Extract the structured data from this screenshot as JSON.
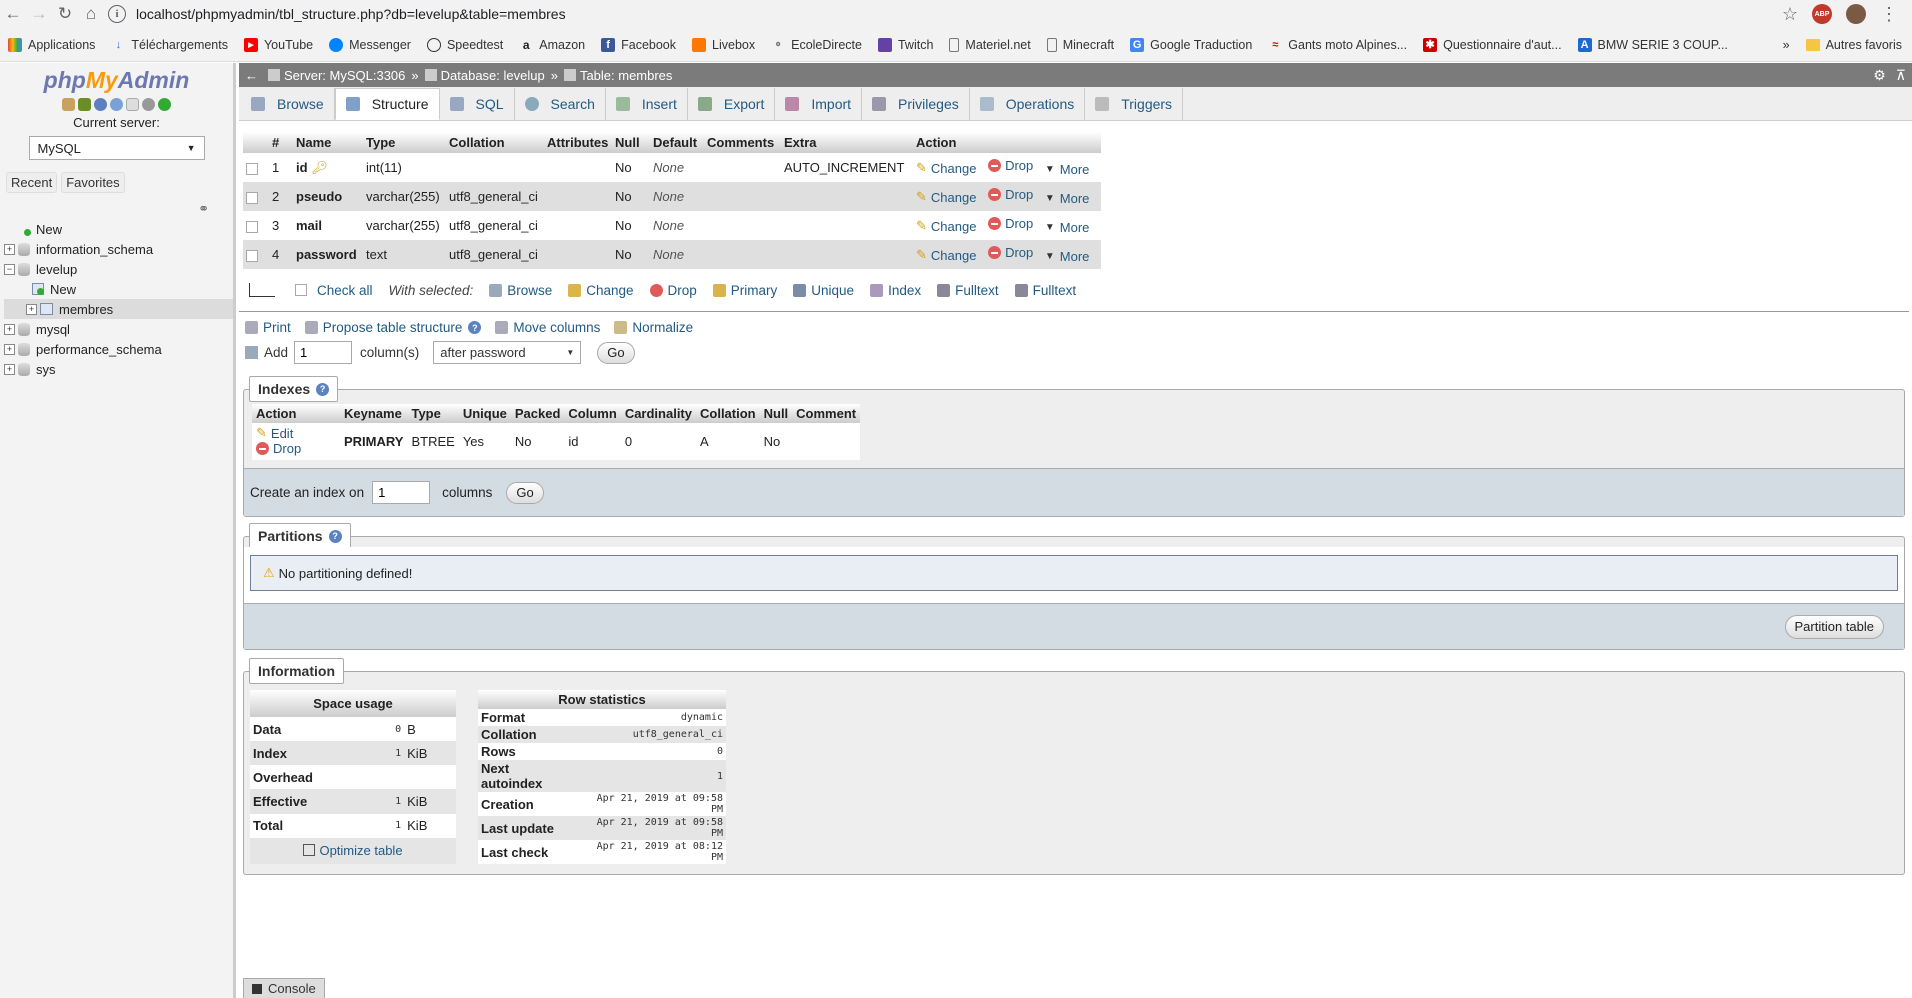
{
  "browser": {
    "url": "localhost/phpmyadmin/tbl_structure.php?db=levelup&table=membres",
    "bookmarks": [
      "Applications",
      "Téléchargements",
      "YouTube",
      "Messenger",
      "Speedtest",
      "Amazon",
      "Facebook",
      "Livebox",
      "EcoleDirecte",
      "Twitch",
      "Materiel.net",
      "Minecraft",
      "Google Traduction",
      "Gants moto Alpines...",
      "Questionnaire d'aut...",
      "BMW SERIE 3 COUP..."
    ],
    "bookmarks_more": "»",
    "other_bookmarks": "Autres favoris",
    "abp": "ABP"
  },
  "sidebar": {
    "logo_php": "php",
    "logo_my": "My",
    "logo_admin": "Admin",
    "current_server_label": "Current server:",
    "server_value": "MySQL",
    "recent": "Recent",
    "favorites": "Favorites",
    "tree": {
      "new_top": "New",
      "information_schema": "information_schema",
      "levelup": "levelup",
      "levelup_new": "New",
      "membres": "membres",
      "mysql": "mysql",
      "performance_schema": "performance_schema",
      "sys": "sys"
    }
  },
  "breadcrumb": {
    "server": "Server: MySQL:3306",
    "database": "Database: levelup",
    "table": "Table: membres",
    "sep": "»"
  },
  "tabs": [
    "Browse",
    "Structure",
    "SQL",
    "Search",
    "Insert",
    "Export",
    "Import",
    "Privileges",
    "Operations",
    "Triggers"
  ],
  "structure": {
    "headers": [
      "#",
      "Name",
      "Type",
      "Collation",
      "Attributes",
      "Null",
      "Default",
      "Comments",
      "Extra",
      "Action"
    ],
    "rows": [
      {
        "num": "1",
        "name": "id",
        "type": "int(11)",
        "collation": "",
        "attributes": "",
        "null": "No",
        "default": "None",
        "comments": "",
        "extra": "AUTO_INCREMENT"
      },
      {
        "num": "2",
        "name": "pseudo",
        "type": "varchar(255)",
        "collation": "utf8_general_ci",
        "attributes": "",
        "null": "No",
        "default": "None",
        "comments": "",
        "extra": ""
      },
      {
        "num": "3",
        "name": "mail",
        "type": "varchar(255)",
        "collation": "utf8_general_ci",
        "attributes": "",
        "null": "No",
        "default": "None",
        "comments": "",
        "extra": ""
      },
      {
        "num": "4",
        "name": "password",
        "type": "text",
        "collation": "utf8_general_ci",
        "attributes": "",
        "null": "No",
        "default": "None",
        "comments": "",
        "extra": ""
      }
    ],
    "action_change": "Change",
    "action_drop": "Drop",
    "action_more": "More"
  },
  "with_selected": {
    "check_all": "Check all",
    "label": "With selected:",
    "actions": [
      "Browse",
      "Change",
      "Drop",
      "Primary",
      "Unique",
      "Index",
      "Fulltext",
      "Fulltext"
    ]
  },
  "tools": {
    "print": "Print",
    "propose": "Propose table structure",
    "move": "Move columns",
    "normalize": "Normalize"
  },
  "add_columns": {
    "add": "Add",
    "count": "1",
    "columns_label": "column(s)",
    "position": "after password",
    "go": "Go"
  },
  "indexes": {
    "legend": "Indexes",
    "headers": [
      "Action",
      "Keyname",
      "Type",
      "Unique",
      "Packed",
      "Column",
      "Cardinality",
      "Collation",
      "Null",
      "Comment"
    ],
    "row": {
      "edit": "Edit",
      "drop": "Drop",
      "keyname": "PRIMARY",
      "type": "BTREE",
      "unique": "Yes",
      "packed": "No",
      "column": "id",
      "cardinality": "0",
      "collation": "A",
      "null": "No",
      "comment": ""
    },
    "create_label": "Create an index on",
    "create_count": "1",
    "create_columns": "columns",
    "go": "Go"
  },
  "partitions": {
    "legend": "Partitions",
    "notice": "No partitioning defined!",
    "button": "Partition table"
  },
  "information": {
    "legend": "Information",
    "space_title": "Space usage",
    "space": [
      {
        "name": "Data",
        "value": "0",
        "unit": "B"
      },
      {
        "name": "Index",
        "value": "1",
        "unit": "KiB"
      },
      {
        "name": "Overhead",
        "value": "",
        "unit": ""
      },
      {
        "name": "Effective",
        "value": "1",
        "unit": "KiB"
      },
      {
        "name": "Total",
        "value": "1",
        "unit": "KiB"
      }
    ],
    "optimize": "Optimize table",
    "row_title": "Row statistics",
    "rows": [
      {
        "name": "Format",
        "value": "dynamic"
      },
      {
        "name": "Collation",
        "value": "utf8_general_ci"
      },
      {
        "name": "Rows",
        "value": "0"
      },
      {
        "name": "Next autoindex",
        "value": "1"
      },
      {
        "name": "Creation",
        "value": "Apr 21, 2019 at 09:58 PM"
      },
      {
        "name": "Last update",
        "value": "Apr 21, 2019 at 09:58 PM"
      },
      {
        "name": "Last check",
        "value": "Apr 21, 2019 at 08:12 PM"
      }
    ]
  },
  "console": "Console"
}
